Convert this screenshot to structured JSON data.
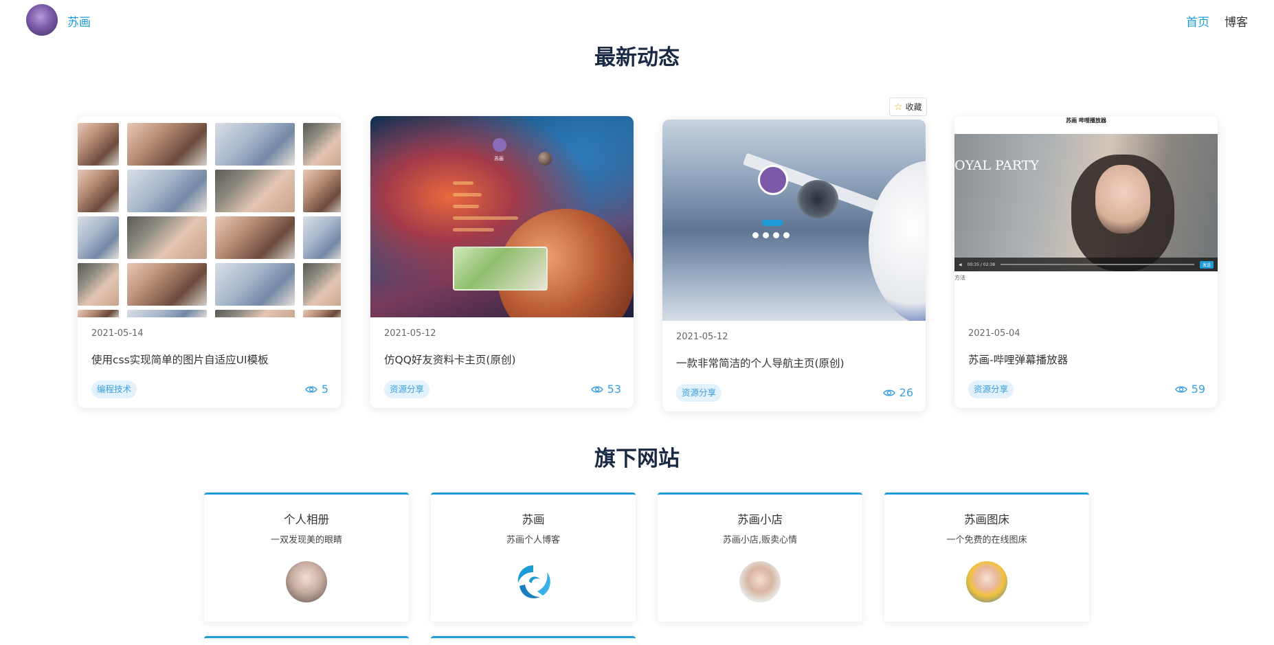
{
  "header": {
    "site_name": "苏画",
    "nav": [
      {
        "label": "首页",
        "active": true
      },
      {
        "label": "博客",
        "active": false
      }
    ]
  },
  "sections": {
    "latest_title": "最新动态",
    "sites_title": "旗下网站"
  },
  "posts": [
    {
      "date": "2021-05-14",
      "title": "使用css实现简单的图片自适应UI模板",
      "tag": "编程技术",
      "views": "5"
    },
    {
      "date": "2021-05-12",
      "title": "仿QQ好友资料卡主页(原创)",
      "tag": "资源分享",
      "views": "53"
    },
    {
      "date": "2021-05-12",
      "title": "一款非常简洁的个人导航主页(原创)",
      "tag": "资源分享",
      "views": "26"
    },
    {
      "date": "2021-05-04",
      "title": "苏画-哔哩弹幕播放器",
      "tag": "资源分享",
      "views": "59"
    }
  ],
  "favorite_label": "收藏",
  "thumb_text": {
    "qq_name": "苏画",
    "player_title": "苏画 哔哩播放器",
    "player_caption": "OYAL PARTY",
    "player_time": "00:35 / 02:38",
    "player_send": "发送",
    "player_foot": "方法"
  },
  "sites": [
    {
      "name": "个人相册",
      "desc": "一双发现美的眼睛",
      "icon": "avatar-photo"
    },
    {
      "name": "苏画",
      "desc": "苏画个人博客",
      "icon": "swirl-logo-icon"
    },
    {
      "name": "苏画小店",
      "desc": "苏画小店,贩卖心情",
      "icon": "avatar-photo"
    },
    {
      "name": "苏画图床",
      "desc": "一个免费的在线图床",
      "icon": "avatar-photo"
    }
  ],
  "colors": {
    "accent": "#1e9bd7",
    "title": "#1b2a44",
    "tag_bg": "#e2f1fb"
  }
}
